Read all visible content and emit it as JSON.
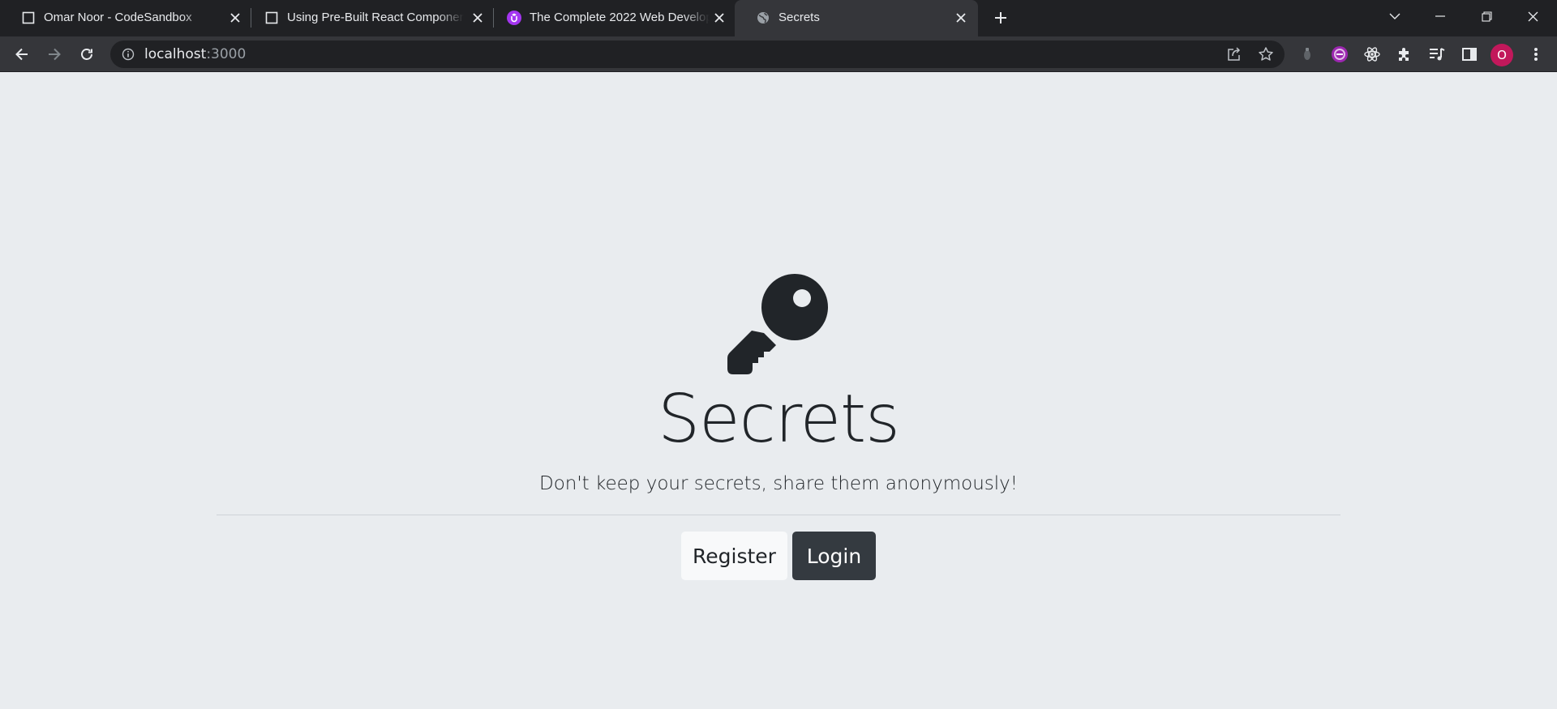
{
  "browser": {
    "tabs": [
      {
        "title": "Omar Noor - CodeSandbox",
        "favicon": "codesandbox-icon"
      },
      {
        "title": "Using Pre-Built React Components",
        "favicon": "codesandbox-icon"
      },
      {
        "title": "The Complete 2022 Web Development Bootcamp",
        "favicon": "udemy-icon"
      },
      {
        "title": "Secrets",
        "favicon": "globe-icon"
      }
    ],
    "active_tab": 3,
    "address": {
      "host": "localhost",
      "port": ":3000"
    },
    "profile_initial": "O",
    "colors": {
      "tabstrip": "#202124",
      "toolbar": "#35363a",
      "profile": "#c2185b",
      "udemy": "#a435f0"
    }
  },
  "page": {
    "title": "Secrets",
    "lead": "Don't keep your secrets, share them anonymously!",
    "buttons": {
      "register": "Register",
      "login": "Login"
    },
    "colors": {
      "background": "#e9ecef",
      "text": "#212529",
      "dark_button": "#343a40",
      "light_button": "#f8f9fa"
    }
  }
}
